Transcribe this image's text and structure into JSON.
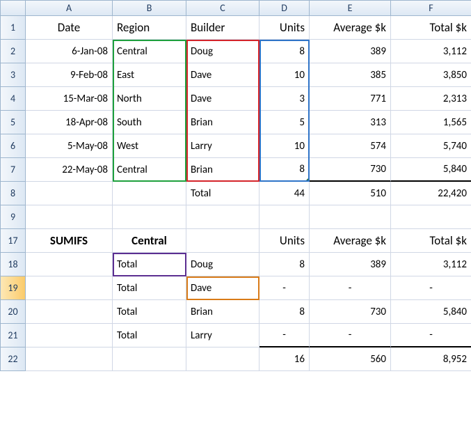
{
  "columnHeaders": [
    "",
    "A",
    "B",
    "C",
    "D",
    "E",
    "F"
  ],
  "rowHeaders": [
    "1",
    "2",
    "3",
    "4",
    "5",
    "6",
    "7",
    "8",
    "9",
    "17",
    "18",
    "19",
    "20",
    "21",
    "22"
  ],
  "selectedRowHeader": "19",
  "header1": {
    "A": "Date",
    "B": "Region",
    "C": "Builder",
    "D": "Units",
    "E": "Average $k",
    "F": "Total $k"
  },
  "data": [
    {
      "A": "6-Jan-08",
      "B": "Central",
      "C": "Doug",
      "D": "8",
      "E": "389",
      "F": "3,112"
    },
    {
      "A": "9-Feb-08",
      "B": "East",
      "C": "Dave",
      "D": "10",
      "E": "385",
      "F": "3,850"
    },
    {
      "A": "15-Mar-08",
      "B": "North",
      "C": "Dave",
      "D": "3",
      "E": "771",
      "F": "2,313"
    },
    {
      "A": "18-Apr-08",
      "B": "South",
      "C": "Brian",
      "D": "5",
      "E": "313",
      "F": "1,565"
    },
    {
      "A": "5-May-08",
      "B": "West",
      "C": "Larry",
      "D": "10",
      "E": "574",
      "F": "5,740"
    },
    {
      "A": "22-May-08",
      "B": "Central",
      "C": "Brian",
      "D": "8",
      "E": "730",
      "F": "5,840"
    }
  ],
  "totalRow": {
    "C": "Total",
    "D": "44",
    "E": "510",
    "F": "22,420"
  },
  "header2": {
    "A": "SUMIFS",
    "B": "Central",
    "D": "Units",
    "E": "Average $k",
    "F": "Total $k"
  },
  "lookup": [
    {
      "B": "Total",
      "C": "Doug",
      "D": "8",
      "E": "389",
      "F": "3,112"
    },
    {
      "B": "Total",
      "C": "Dave",
      "D": "-",
      "E": "-",
      "F": "-"
    },
    {
      "B": "Total",
      "C": "Brian",
      "D": "8",
      "E": "730",
      "F": "5,840"
    },
    {
      "B": "Total",
      "C": "Larry",
      "D": "-",
      "E": "-",
      "F": "-"
    }
  ],
  "grand": {
    "D": "16",
    "E": "560",
    "F": "8,952"
  },
  "boxes": {
    "green": {
      "range": "B2:B7"
    },
    "red": {
      "range": "C2:C7"
    },
    "blue": {
      "range": "D2:D7"
    },
    "purple": {
      "range": "B17"
    },
    "orange": {
      "range": "C18"
    }
  }
}
